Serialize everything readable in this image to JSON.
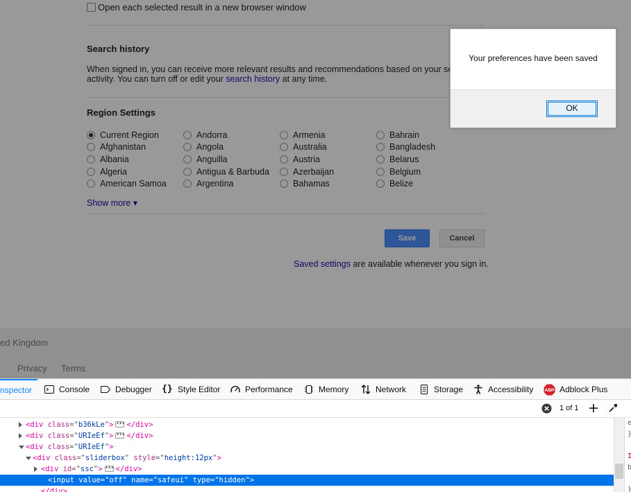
{
  "settings": {
    "new_window_label": "Open each selected result in a new browser window",
    "search_history": {
      "title": "Search history",
      "desc_line1": "When signed in, you can receive more relevant results and recommendations based on your sea",
      "desc_line2_pre": "activity. You can turn off or edit your ",
      "desc_link": "search history",
      "desc_line2_post": " at any time."
    },
    "region": {
      "title": "Region Settings",
      "columns": [
        [
          "Current Region",
          "Afghanistan",
          "Albania",
          "Algeria",
          "American Samoa"
        ],
        [
          "Andorra",
          "Angola",
          "Anguilla",
          "Antigua & Barbuda",
          "Argentina"
        ],
        [
          "Armenia",
          "Australia",
          "Austria",
          "Azerbaijan",
          "Bahamas"
        ],
        [
          "Bahrain",
          "Bangladesh",
          "Belarus",
          "Belgium",
          "Belize"
        ]
      ],
      "selected": "Current Region",
      "show_more": "Show more ▾"
    },
    "save_label": "Save",
    "cancel_label": "Cancel",
    "saved_settings_link": "Saved settings",
    "saved_settings_text": " are available whenever you sign in."
  },
  "footer": {
    "location": "ed Kingdom",
    "privacy": "Privacy",
    "terms": "Terms"
  },
  "dialog": {
    "message": "Your preferences have been saved",
    "ok_label": "OK"
  },
  "devtools": {
    "tabs": [
      {
        "label": "nspector",
        "icon": "inspector-icon"
      },
      {
        "label": "Console",
        "icon": "console-icon"
      },
      {
        "label": "Debugger",
        "icon": "debugger-icon"
      },
      {
        "label": "Style Editor",
        "icon": "braces-icon"
      },
      {
        "label": "Performance",
        "icon": "performance-gauge-icon"
      },
      {
        "label": "Memory",
        "icon": "memory-chip-icon"
      },
      {
        "label": "Network",
        "icon": "network-arrows-icon"
      },
      {
        "label": "Storage",
        "icon": "storage-icon"
      },
      {
        "label": "Accessibility",
        "icon": "accessibility-person-icon"
      },
      {
        "label": "Adblock Plus",
        "icon": "adblock-plus-icon",
        "badge": "ABP"
      }
    ],
    "search_count": "1 of 1",
    "tree": [
      {
        "tag": "div",
        "attr": "class",
        "val": "b36kLe",
        "collapsed": true,
        "close": "</div>"
      },
      {
        "tag": "div",
        "attr": "class",
        "val": "URIeEf",
        "collapsed": true,
        "close": "</div>"
      },
      {
        "tag": "div",
        "attr": "class",
        "val": "URIeEf",
        "expanded": true
      },
      {
        "tag": "div",
        "attr": "class",
        "val": "sliderbox",
        "attr2": "style",
        "val2": "height:12px",
        "expanded": true
      },
      {
        "tag": "div",
        "attr": "id",
        "val": "ssc",
        "collapsed": true,
        "close": "</div>"
      },
      {
        "raw": "<input value=\"off\" name=\"safeui\" type=\"hidden\">",
        "selected": true
      },
      {
        "raw": "</div>"
      }
    ],
    "side_chars": [
      "e",
      "}",
      "",
      "I",
      "b",
      "",
      "}"
    ]
  },
  "colors": {
    "accent_blue": "#0a84ff",
    "save_button": "#4d90fe",
    "link": "#1a0dab",
    "selection": "#0074e8",
    "adblock_red": "#d3222a"
  }
}
